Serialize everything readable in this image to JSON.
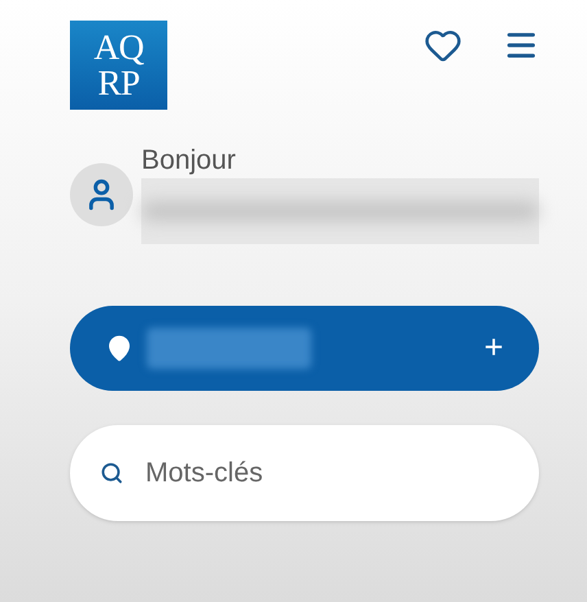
{
  "header": {
    "logo": {
      "letters_top": "AQ",
      "letters_bottom": "RP"
    }
  },
  "greeting": {
    "text": "Bonjour"
  },
  "location_bar": {
    "action": "+"
  },
  "search": {
    "placeholder": "Mots-clés"
  }
}
